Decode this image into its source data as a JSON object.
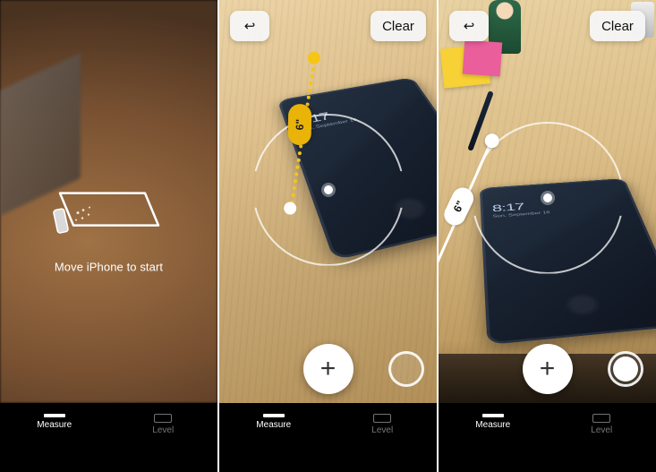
{
  "accent_yellow": "#f5c518",
  "screen1": {
    "instruction": "Move iPhone to start",
    "tabs": {
      "measure": "Measure",
      "level": "Level",
      "active": "measure"
    }
  },
  "screen2": {
    "undo_label": "↩",
    "clear_label": "Clear",
    "add_label": "+",
    "measurement_readout": "6\"",
    "phone_clock": "8:17",
    "phone_clock_sub": "Sun, September 16",
    "tabs": {
      "measure": "Measure",
      "level": "Level",
      "active": "measure"
    }
  },
  "screen3": {
    "undo_label": "↩",
    "clear_label": "Clear",
    "add_label": "+",
    "measurement_readout": "6\"",
    "phone_clock": "8:17",
    "phone_clock_sub": "Sun, September 16",
    "tabs": {
      "measure": "Measure",
      "level": "Level",
      "active": "measure"
    }
  }
}
